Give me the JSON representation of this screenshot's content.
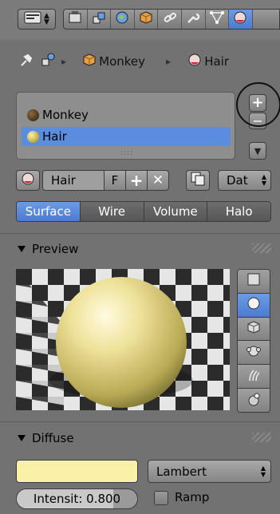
{
  "header": {
    "editor_icon": "properties-editor-icon",
    "context_tabs": [
      {
        "icon": "render-icon",
        "active": false
      },
      {
        "icon": "render-layers-icon",
        "active": false
      },
      {
        "icon": "world-icon",
        "active": false
      },
      {
        "icon": "object-icon",
        "active": false
      },
      {
        "icon": "constraints-icon",
        "active": false
      },
      {
        "icon": "modifier-wrench-icon",
        "active": false
      },
      {
        "icon": "vertex-data-icon",
        "active": false
      },
      {
        "icon": "material-icon",
        "active": true
      }
    ]
  },
  "breadcrumb": {
    "object": "Monkey",
    "material": "Hair"
  },
  "slots": {
    "items": [
      {
        "label": "Monkey",
        "color": "#3a2c1a",
        "selected": false
      },
      {
        "label": "Hair",
        "color": "#c6b23c",
        "selected": true
      }
    ],
    "add_symbol": "+",
    "remove_symbol": "−",
    "down_symbol": "▼"
  },
  "material": {
    "name": "Hair",
    "fake_user": "F",
    "add_symbol": "+",
    "unlink_symbol": "✕",
    "data_select": "Dat"
  },
  "tabs": [
    {
      "label": "Surface",
      "active": true
    },
    {
      "label": "Wire",
      "active": false
    },
    {
      "label": "Volume",
      "active": false
    },
    {
      "label": "Halo",
      "active": false
    }
  ],
  "preview": {
    "title": "Preview",
    "shapes": [
      "plane-icon",
      "sphere-icon",
      "cube-icon",
      "monkey-icon",
      "hair-icon",
      "sphere-sky-icon"
    ],
    "active_shape": 1
  },
  "diffuse": {
    "title": "Diffuse",
    "color": "#f9f1a6",
    "shader": "Lambert",
    "intensity_label": "Intensit: 0.800",
    "intensity": 0.8,
    "ramp_label": "Ramp"
  },
  "colors": {
    "accent": "#5a8de0"
  }
}
